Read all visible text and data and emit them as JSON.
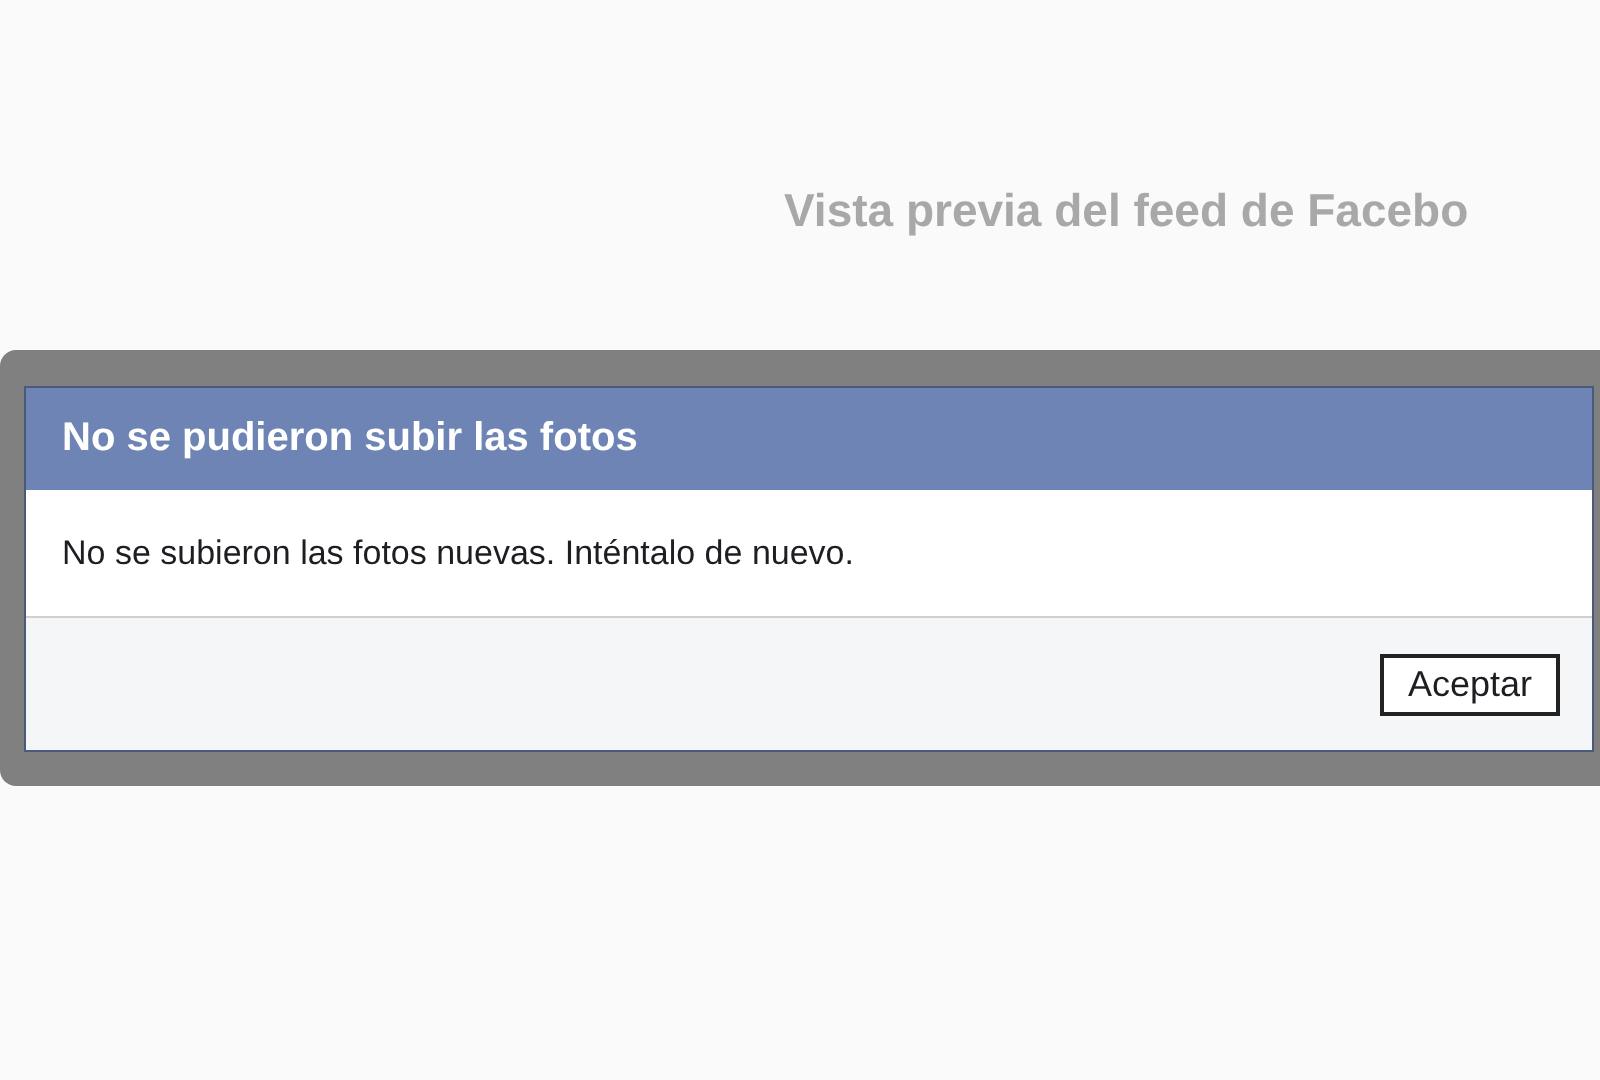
{
  "background_page": {
    "heading": "Vista previa del feed de Facebo"
  },
  "dialog": {
    "title": "No se pudieron subir las fotos",
    "message": "No se subieron las fotos nuevas. Inténtalo de nuevo.",
    "buttons": [
      "Aceptar"
    ]
  }
}
